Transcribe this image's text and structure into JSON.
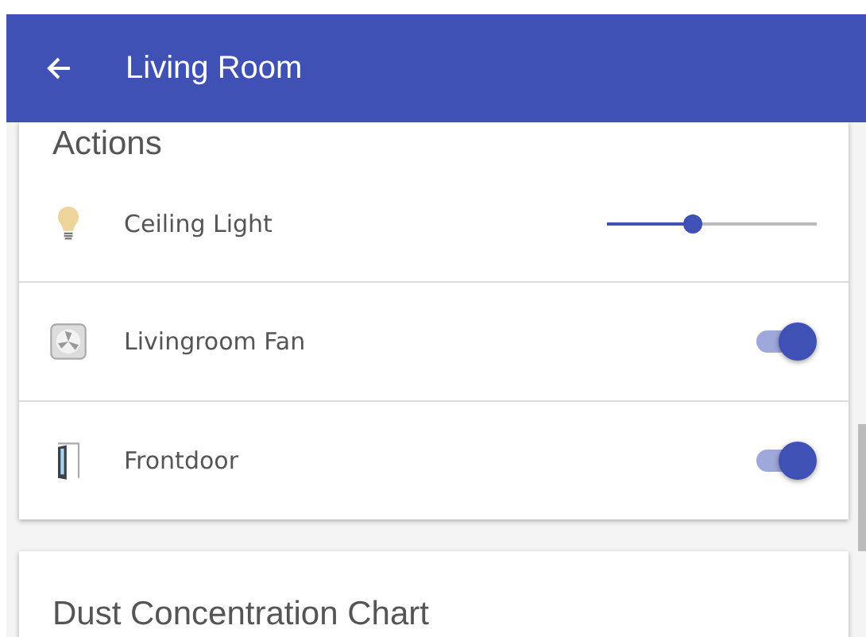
{
  "app_bar": {
    "title": "Living Room"
  },
  "actions_card": {
    "title": "Actions",
    "rows": [
      {
        "kind": "slider",
        "label": "Ceiling Light",
        "level": 0.41
      },
      {
        "kind": "toggle",
        "label": "Livingroom Fan",
        "on": true
      },
      {
        "kind": "toggle",
        "label": "Frontdoor",
        "on": true
      }
    ]
  },
  "chart_card": {
    "title": "Dust Concentration Chart"
  }
}
